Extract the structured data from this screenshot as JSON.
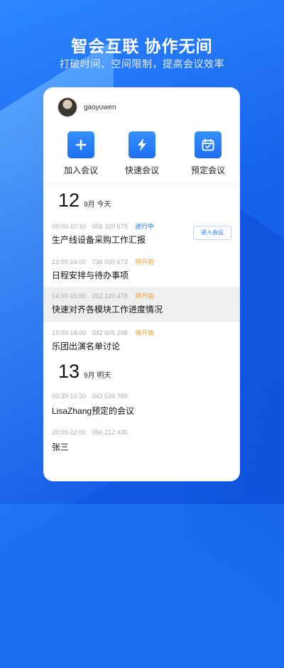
{
  "headline": "智会互联 协作无间",
  "subline": "打破时间、空间限制，提高会议效率",
  "user": {
    "name": "gaoyuwen"
  },
  "actions": [
    {
      "label": "加入会议",
      "icon": "plus-icon"
    },
    {
      "label": "快速会议",
      "icon": "lightning-icon"
    },
    {
      "label": "预定会议",
      "icon": "calendar-icon"
    }
  ],
  "days": [
    {
      "num": "12",
      "text": "9月 今天",
      "meetings": [
        {
          "time": "09:00-10:30",
          "id": "458 320 579",
          "status": "进行中",
          "status_type": "live",
          "title": "生产线设备采购工作汇报",
          "button": "进入会议"
        },
        {
          "time": "13:00-14:00",
          "id": "736 035 673",
          "status": "待开始",
          "status_type": "pending",
          "title": "日程安排与待办事项"
        },
        {
          "time": "14:00-15:00",
          "id": "252 120 478",
          "status": "待开始",
          "status_type": "pending",
          "title": "快速对齐各模块工作进度情况",
          "highlight": true
        },
        {
          "time": "15:00-18:00",
          "id": "342 605 298",
          "status": "待开始",
          "status_type": "pending",
          "title": "乐团出演名单讨论"
        }
      ]
    },
    {
      "num": "13",
      "text": "9月 明天",
      "meetings": [
        {
          "time": "09:30-10:30",
          "id": "342 534 789",
          "status": "",
          "title": "LisaZhang预定的会议"
        },
        {
          "time": "20:00-22:00",
          "id": "356 212 436",
          "status": "",
          "title": "张三"
        }
      ]
    }
  ],
  "colors": {
    "accent": "#1d6ff2",
    "pending": "#f0a020",
    "background": "#1a6ff0"
  }
}
